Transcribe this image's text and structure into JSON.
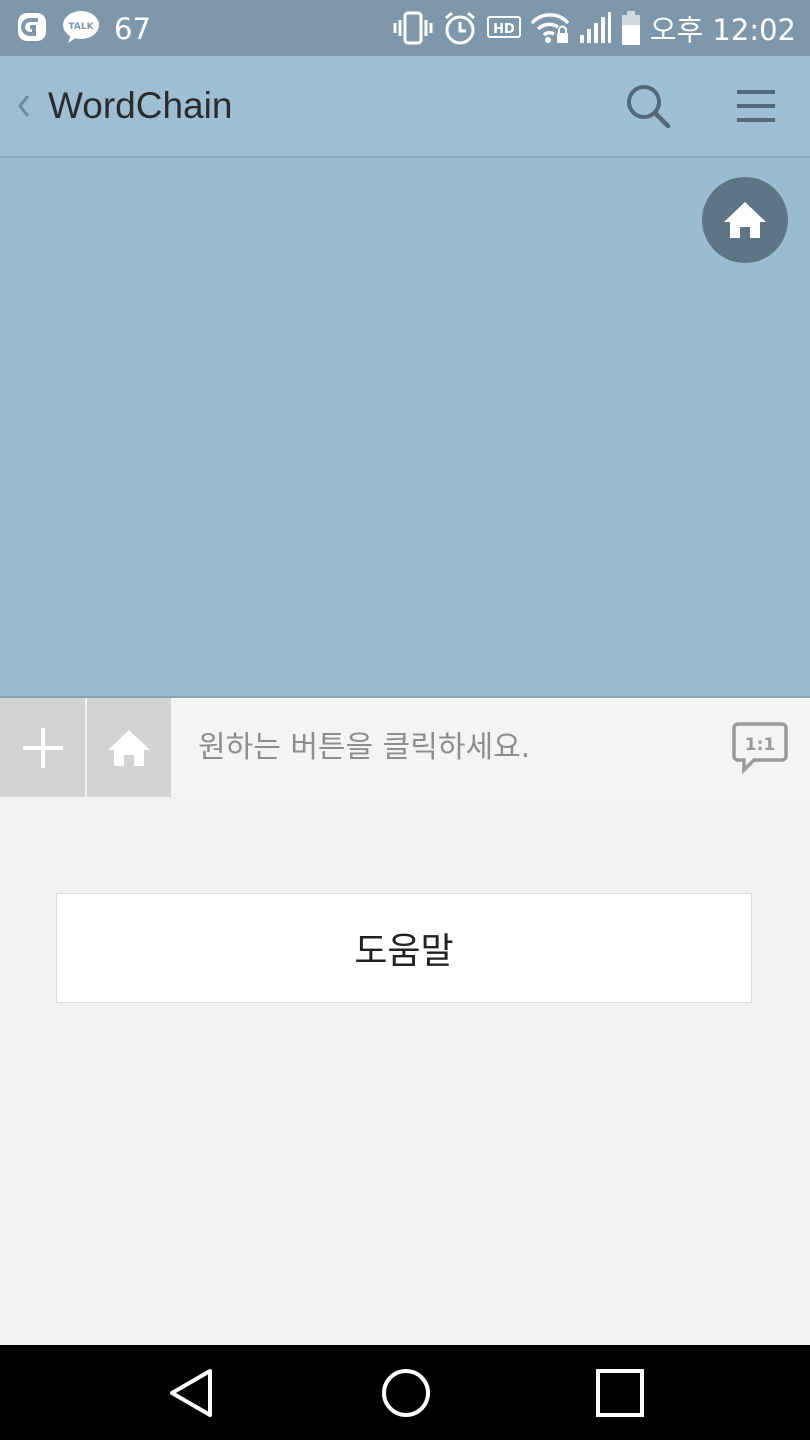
{
  "status_bar": {
    "notification_count": "67",
    "talk_label": "TALK",
    "hd_label": "HD",
    "time": "오후 12:02"
  },
  "app_bar": {
    "title": "WordChain"
  },
  "input_bar": {
    "hint": "원하는 버튼을 클릭하세요.",
    "one_to_one_label": "1:1"
  },
  "menu": {
    "help_button_label": "도움말"
  },
  "colors": {
    "status_bar": "#7e97ab",
    "app_bar": "#9dbed4",
    "chat_background": "#9abbd2",
    "home_fab": "#5d7585",
    "input_side_buttons": "#d3d3d3"
  },
  "icons": [
    "g-icon",
    "talk-icon",
    "vibrate-icon",
    "alarm-icon",
    "hd-icon",
    "wifi-lock-icon",
    "signal-icon",
    "battery-icon",
    "back-chevron-icon",
    "search-icon",
    "hamburger-menu-icon",
    "home-icon",
    "plus-icon",
    "one-to-one-chat-icon",
    "nav-back-icon",
    "nav-home-icon",
    "nav-recent-icon"
  ]
}
